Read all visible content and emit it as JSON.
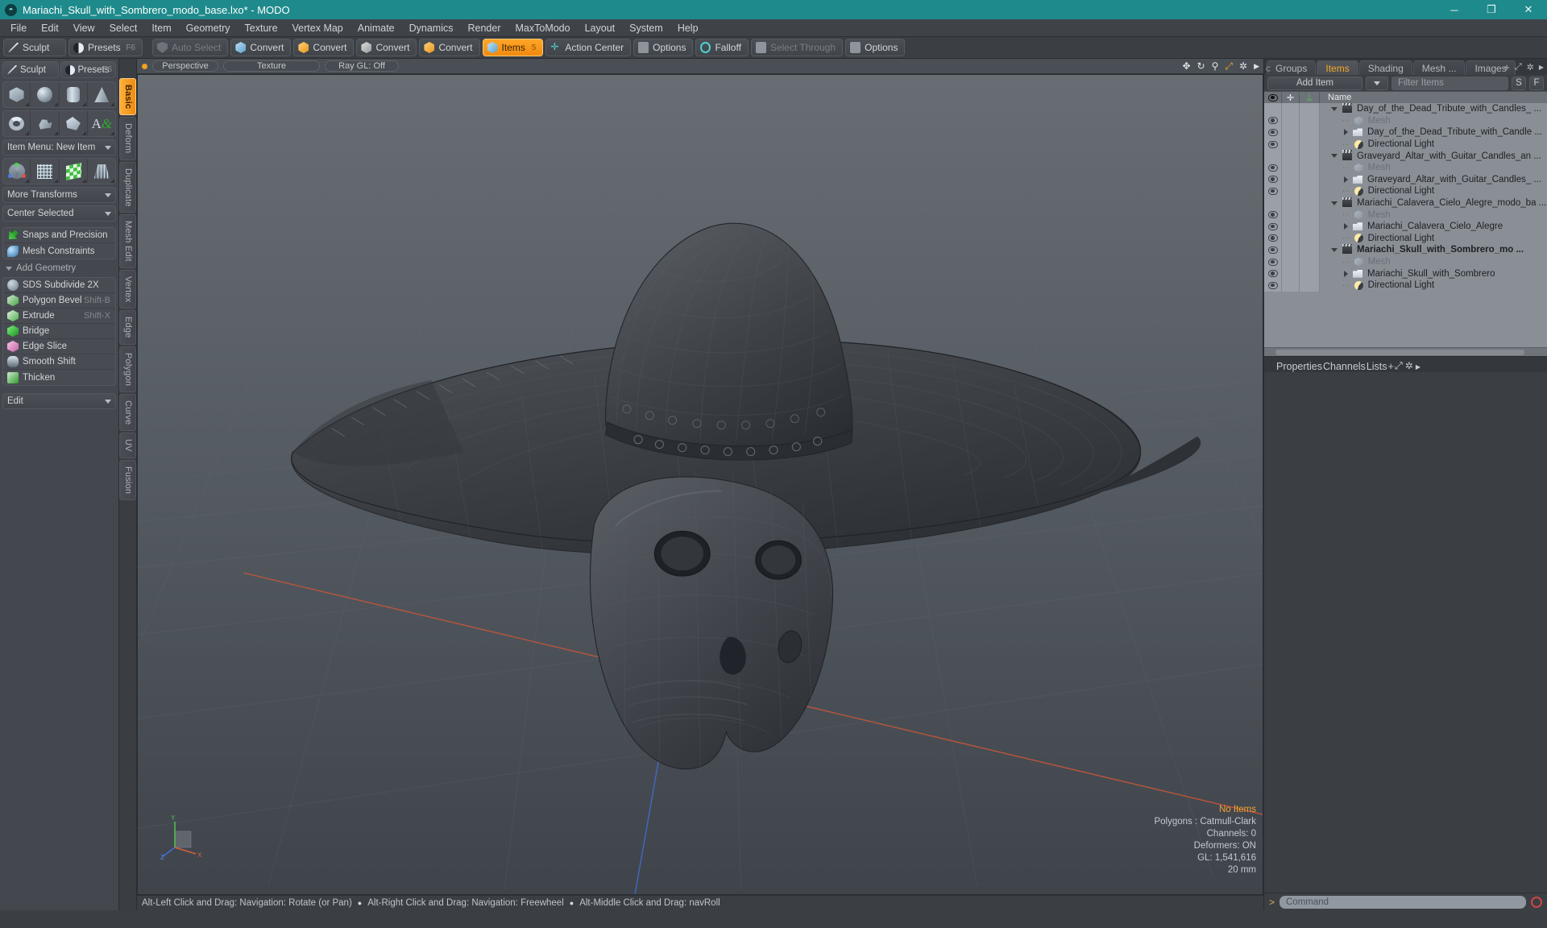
{
  "window": {
    "title": "Mariachi_Skull_with_Sombrero_modo_base.lxo* - MODO",
    "logo": "modo-logo-icon",
    "buttons": {
      "minimize": "─",
      "maximize": "❐",
      "close": "✕"
    }
  },
  "menubar": {
    "items": [
      "File",
      "Edit",
      "View",
      "Select",
      "Item",
      "Geometry",
      "Texture",
      "Vertex Map",
      "Animate",
      "Dynamics",
      "Render",
      "MaxToModo",
      "Layout",
      "System",
      "Help"
    ]
  },
  "toolbar": {
    "left": [
      {
        "label": "Sculpt",
        "icon": "pen-icon"
      },
      {
        "label": "Presets",
        "icon": "presets-icon",
        "shortcut": "F6"
      }
    ],
    "right": [
      {
        "label": "Auto Select",
        "icon": "shield-icon",
        "state": "dim"
      },
      {
        "label": "Convert",
        "icon": "cube-blue-icon"
      },
      {
        "label": "Convert",
        "icon": "cube-orange-icon"
      },
      {
        "label": "Convert",
        "icon": "cube-white-icon"
      },
      {
        "label": "Convert",
        "icon": "cube-orange-icon"
      },
      {
        "label": "Items",
        "icon": "cube-blue-icon",
        "state": "active",
        "badge": "5"
      },
      {
        "label": "Action Center",
        "icon": "crosshair-icon"
      },
      {
        "label": "Options",
        "icon": "panel-icon"
      },
      {
        "label": "Falloff",
        "icon": "ring-icon"
      },
      {
        "label": "Select Through",
        "icon": "panel-icon",
        "state": "dim"
      },
      {
        "label": "Options",
        "icon": "panel-icon"
      }
    ]
  },
  "leftpanel": {
    "top_buttons": [
      {
        "label": "Sculpt",
        "icon": "pen-icon"
      },
      {
        "label": "Presets",
        "icon": "presets-icon",
        "shortcut": "F6"
      }
    ],
    "primitives_row1": [
      "cube-icon",
      "sphere-icon",
      "cylinder-icon",
      "cone-icon"
    ],
    "primitives_row2": [
      "torus-icon",
      "spiral-icon",
      "polygon-icon",
      "text-icon"
    ],
    "item_menu": "Item Menu: New Item",
    "transform_row": [
      "axis-gizmo-icon",
      "grid-plane-icon",
      "checker-icon",
      "lattice-icon"
    ],
    "more_transforms": "More Transforms",
    "center_selected": "Center Selected",
    "snaps": "Snaps and Precision",
    "mesh_constraints": "Mesh Constraints",
    "add_geometry_header": "Add Geometry",
    "tools": [
      {
        "label": "SDS Subdivide 2X",
        "icon": "sds-icon",
        "shortcut": ""
      },
      {
        "label": "Polygon Bevel",
        "icon": "bevel-icon",
        "shortcut": "Shift-B"
      },
      {
        "label": "Extrude",
        "icon": "extrude-icon",
        "shortcut": "Shift-X"
      },
      {
        "label": "Bridge",
        "icon": "bridge-icon",
        "shortcut": ""
      },
      {
        "label": "Edge Slice",
        "icon": "slice-icon",
        "shortcut": ""
      },
      {
        "label": "Smooth Shift",
        "icon": "smoothshift-icon",
        "shortcut": ""
      },
      {
        "label": "Thicken",
        "icon": "thicken-icon",
        "shortcut": ""
      }
    ],
    "edit_dropdown": "Edit"
  },
  "vtabs": {
    "items": [
      "Basic",
      "Deform",
      "Duplicate",
      "Mesh Edit",
      "Vertex",
      "Edge",
      "Polygon",
      "Curve",
      "UV",
      "Fusion"
    ],
    "active": "Basic"
  },
  "viewport": {
    "header_tags": [
      "Perspective",
      "Texture",
      "Ray GL: Off"
    ],
    "stats": {
      "items": "No Items",
      "polygons": "Polygons : Catmull-Clark",
      "channels": "Channels: 0",
      "deformers": "Deformers: ON",
      "gl": "GL: 1,541,616",
      "scale": "20 mm"
    },
    "axis_labels": {
      "y": "Y",
      "x": "X",
      "z": "Z"
    }
  },
  "statusbar": {
    "segments": [
      "Alt-Left Click and Drag: Navigation: Rotate (or Pan)",
      "Alt-Right Click and Drag: Navigation: Freewheel",
      "Alt-Middle Click and Drag: navRoll"
    ],
    "bullet": "●"
  },
  "rightpanel": {
    "tabs": [
      "Groups",
      "Items",
      "Shading",
      "Mesh ...",
      "Images"
    ],
    "active_tab": "Items",
    "plus": "+",
    "add_item": "Add Item",
    "filter_placeholder": "Filter Items",
    "filter_value": "Filter Items",
    "btn_s": "S",
    "btn_f": "F",
    "list_header": {
      "eye": "visibility-icon",
      "lock": "lock-icon",
      "axis": "axis-icon",
      "name": "Name"
    },
    "rows": [
      {
        "label": "Day_of_the_Dead_Tribute_with_Candles_ ...",
        "icon": "scene-icon",
        "indent": 0,
        "twist": "down",
        "eye": false,
        "dim": false,
        "bold": false
      },
      {
        "label": "Mesh",
        "icon": "mesh-icon",
        "indent": 1,
        "twist": "leaf",
        "eye": true,
        "dim": true,
        "bold": false
      },
      {
        "label": "Day_of_the_Dead_Tribute_with_Candle ...",
        "icon": "folder-icon",
        "indent": 1,
        "twist": "right",
        "eye": true,
        "dim": false,
        "bold": false
      },
      {
        "label": "Directional Light",
        "icon": "light-icon",
        "indent": 1,
        "twist": "leaf",
        "eye": true,
        "dim": false,
        "bold": false
      },
      {
        "label": "Graveyard_Altar_with_Guitar_Candles_an ...",
        "icon": "scene-icon",
        "indent": 0,
        "twist": "down",
        "eye": false,
        "dim": false,
        "bold": false
      },
      {
        "label": "Mesh",
        "icon": "mesh-icon",
        "indent": 1,
        "twist": "leaf",
        "eye": true,
        "dim": true,
        "bold": false
      },
      {
        "label": "Graveyard_Altar_with_Guitar_Candles_ ...",
        "icon": "folder-icon",
        "indent": 1,
        "twist": "right",
        "eye": true,
        "dim": false,
        "bold": false
      },
      {
        "label": "Directional Light",
        "icon": "light-icon",
        "indent": 1,
        "twist": "leaf",
        "eye": true,
        "dim": false,
        "bold": false
      },
      {
        "label": "Mariachi_Calavera_Cielo_Alegre_modo_ba ...",
        "icon": "scene-icon",
        "indent": 0,
        "twist": "down",
        "eye": false,
        "dim": false,
        "bold": false
      },
      {
        "label": "Mesh",
        "icon": "mesh-icon",
        "indent": 1,
        "twist": "leaf",
        "eye": true,
        "dim": true,
        "bold": false
      },
      {
        "label": "Mariachi_Calavera_Cielo_Alegre",
        "icon": "folder-icon",
        "indent": 1,
        "twist": "right",
        "eye": true,
        "dim": false,
        "bold": false
      },
      {
        "label": "Directional Light",
        "icon": "light-icon",
        "indent": 1,
        "twist": "leaf",
        "eye": true,
        "dim": false,
        "bold": false
      },
      {
        "label": "Mariachi_Skull_with_Sombrero_mo ...",
        "icon": "scene-icon",
        "indent": 0,
        "twist": "down",
        "eye": true,
        "dim": false,
        "bold": true
      },
      {
        "label": "Mesh",
        "icon": "mesh-icon",
        "indent": 1,
        "twist": "leaf",
        "eye": true,
        "dim": true,
        "bold": false
      },
      {
        "label": "Mariachi_Skull_with_Sombrero",
        "icon": "folder-icon",
        "indent": 1,
        "twist": "right",
        "eye": true,
        "dim": false,
        "bold": false
      },
      {
        "label": "Directional Light",
        "icon": "light-icon",
        "indent": 1,
        "twist": "leaf",
        "eye": true,
        "dim": false,
        "bold": false
      }
    ],
    "bottom_tabs": [
      "Properties",
      "Channels",
      "Lists"
    ],
    "bottom_active": "Properties",
    "bottom_plus": "+"
  },
  "command": {
    "prompt": ">",
    "placeholder": "Command",
    "value": "",
    "record_icon": "record-icon"
  },
  "colors": {
    "titlebar": "#1f8a8c",
    "accent_orange": "#f5a623",
    "panel_bg": "#3b3f44",
    "list_bg": "#8a8f96",
    "axis_x": "#d4603c",
    "axis_z": "#3f6fd4",
    "axis_y": "#4fbf4f"
  }
}
